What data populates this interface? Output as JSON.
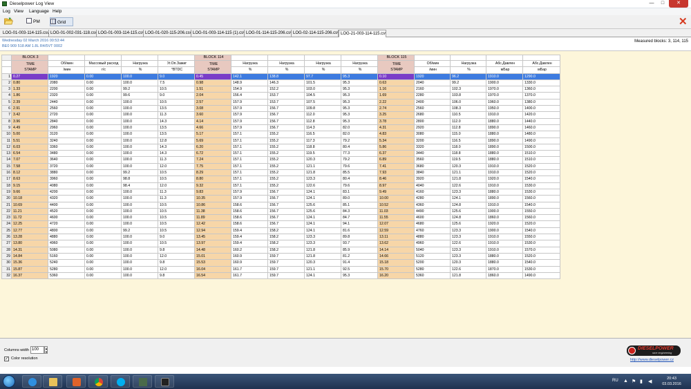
{
  "window": {
    "title": "Dieselpower Log View",
    "minimize": "—",
    "maximize": "□",
    "close": "✕"
  },
  "menu": [
    "Log",
    "View",
    "Language",
    "Help"
  ],
  "toolbar": {
    "pm_label": "PM",
    "grid_label": "Grid",
    "open_icon": "folder-open-icon",
    "exit_icon": "close-x-icon",
    "exit_glyph": "✕"
  },
  "tabs": [
    "LOG-01-003-114-115.csv",
    "LOG-01-002-031-118.csv",
    "LOG-01-003-114-115.csv",
    "LOG-01-020-115-206.csv",
    "LOG-01-003-114-115 (1).csv",
    "LOG-01-114-115-206.csv",
    "LOG-02-114-115-206.csv",
    "LOG-21-003-114-115.csv"
  ],
  "info": {
    "date_line": "Wednesday 02 March 2016 00:53:44",
    "ecu_line": "BE0 909 518 AM   1.8L R4/5VT       0002"
  },
  "measured_blocks": "Measured blocks: 3, 114, 115",
  "grid": {
    "block_headers": {
      "b3": "BLOCK 3",
      "b114": "BLOCK 114",
      "b115": "BLOCK 115"
    },
    "param_names": [
      "",
      "Об/мин",
      "Массовый расход",
      "Нагрузка",
      "Уг.Оп.Зажиг",
      "",
      "Нагрузка",
      "Нагрузка",
      "Нагрузка",
      "Нагрузка",
      "",
      "Об/мин",
      "Нагрузка",
      "Абс.Давлен",
      "Абс.Давлен"
    ],
    "units": [
      "",
      "/мин",
      "г/с",
      "%",
      "°BTDC",
      "",
      "%",
      "%",
      "%",
      "%",
      "",
      "/мин",
      "%",
      "мБар",
      "мБар"
    ],
    "timestamp_label_1": "TIME",
    "timestamp_label_2": "STAMP",
    "rows": [
      [
        "1",
        "0.27",
        "1920",
        "0.00",
        "100.0",
        "9.0",
        "0.45",
        "142.1",
        "138.8",
        "97.7",
        "95.3",
        "0.10",
        "1920",
        "96.2",
        "1910.0",
        "1290.0"
      ],
      [
        "2",
        "0.80",
        "2080",
        "0.00",
        "100.0",
        "7.5",
        "0.98",
        "148.9",
        "146.3",
        "101.5",
        "95.3",
        "0.63",
        "2040",
        "99.2",
        "1900.0",
        "1330.0"
      ],
      [
        "3",
        "1.33",
        "2200",
        "0.00",
        "99.2",
        "10.5",
        "1.51",
        "154.9",
        "152.2",
        "103.0",
        "95.3",
        "1.16",
        "2160",
        "102.3",
        "1970.0",
        "1360.0"
      ],
      [
        "4",
        "1.86",
        "2320",
        "0.00",
        "99.6",
        "9.0",
        "2.04",
        "156.4",
        "153.7",
        "104.5",
        "95.3",
        "1.69",
        "2280",
        "103.8",
        "1970.0",
        "1370.0"
      ],
      [
        "5",
        "2.39",
        "2440",
        "0.00",
        "100.0",
        "10.5",
        "2.57",
        "157.9",
        "153.7",
        "107.5",
        "95.3",
        "2.22",
        "2400",
        "106.0",
        "1960.0",
        "1380.0"
      ],
      [
        "6",
        "2.91",
        "2560",
        "0.00",
        "100.0",
        "13.5",
        "3.08",
        "157.9",
        "156.7",
        "109.8",
        "95.3",
        "2.74",
        "2560",
        "108.3",
        "1950.0",
        "1400.0"
      ],
      [
        "7",
        "3.42",
        "2720",
        "0.00",
        "100.0",
        "11.3",
        "3.60",
        "157.9",
        "156.7",
        "112.0",
        "95.3",
        "3.25",
        "2680",
        "110.5",
        "1910.0",
        "1420.0"
      ],
      [
        "8",
        "3.96",
        "2840",
        "0.00",
        "100.0",
        "14.3",
        "4.14",
        "157.9",
        "156.7",
        "112.8",
        "95.3",
        "3.78",
        "2800",
        "112.0",
        "1880.0",
        "1440.0"
      ],
      [
        "9",
        "4.49",
        "2960",
        "0.00",
        "100.0",
        "13.5",
        "4.66",
        "157.9",
        "156.7",
        "114.3",
        "82.0",
        "4.31",
        "2920",
        "112.8",
        "1890.0",
        "1460.0"
      ],
      [
        "10",
        "5.00",
        "3120",
        "0.00",
        "100.0",
        "13.5",
        "5.17",
        "157.1",
        "155.2",
        "116.5",
        "82.0",
        "4.83",
        "3080",
        "115.0",
        "1880.0",
        "1480.0"
      ],
      [
        "11",
        "5.51",
        "3240",
        "0.00",
        "100.0",
        "12.8",
        "5.69",
        "157.1",
        "155.2",
        "117.3",
        "79.2",
        "5.34",
        "3200",
        "116.5",
        "1890.0",
        "1490.0"
      ],
      [
        "12",
        "6.03",
        "3360",
        "0.00",
        "100.0",
        "14.3",
        "6.20",
        "157.1",
        "155.2",
        "118.8",
        "80.4",
        "5.86",
        "3320",
        "118.0",
        "1890.0",
        "1500.0"
      ],
      [
        "13",
        "6.54",
        "3480",
        "0.00",
        "100.0",
        "14.3",
        "6.72",
        "157.1",
        "155.2",
        "119.5",
        "77.3",
        "6.37",
        "3440",
        "118.8",
        "1880.0",
        "1510.0"
      ],
      [
        "14",
        "7.07",
        "3640",
        "0.00",
        "100.0",
        "11.3",
        "7.24",
        "157.1",
        "155.2",
        "120.3",
        "79.2",
        "6.89",
        "3560",
        "119.5",
        "1880.0",
        "1510.0"
      ],
      [
        "15",
        "7.58",
        "3720",
        "0.00",
        "100.0",
        "12.0",
        "7.75",
        "157.1",
        "155.2",
        "121.1",
        "79.6",
        "7.41",
        "3680",
        "120.3",
        "1910.0",
        "1520.0"
      ],
      [
        "16",
        "8.12",
        "3880",
        "0.00",
        "99.2",
        "10.5",
        "8.29",
        "157.1",
        "155.2",
        "121.8",
        "85.5",
        "7.93",
        "3840",
        "121.1",
        "1910.0",
        "1520.0"
      ],
      [
        "17",
        "8.63",
        "3960",
        "0.00",
        "98.8",
        "10.5",
        "8.80",
        "157.1",
        "155.2",
        "123.3",
        "80.4",
        "8.46",
        "3920",
        "121.8",
        "1920.0",
        "1540.0"
      ],
      [
        "18",
        "9.15",
        "4080",
        "0.00",
        "98.4",
        "12.0",
        "9.32",
        "157.1",
        "155.2",
        "122.6",
        "79.6",
        "8.97",
        "4040",
        "122.6",
        "1910.0",
        "1530.0"
      ],
      [
        "19",
        "9.66",
        "4200",
        "0.00",
        "100.0",
        "11.3",
        "9.83",
        "157.9",
        "156.7",
        "124.1",
        "83.1",
        "9.49",
        "4160",
        "123.3",
        "1880.0",
        "1530.0"
      ],
      [
        "20",
        "10.18",
        "4320",
        "0.00",
        "100.0",
        "11.3",
        "10.35",
        "157.9",
        "156.7",
        "124.1",
        "89.0",
        "10.00",
        "4280",
        "124.1",
        "1890.0",
        "1560.0"
      ],
      [
        "21",
        "10.69",
        "4400",
        "0.00",
        "100.0",
        "10.5",
        "10.86",
        "158.6",
        "156.7",
        "125.6",
        "85.1",
        "10.52",
        "4360",
        "124.8",
        "1910.0",
        "1540.0"
      ],
      [
        "22",
        "11.21",
        "4520",
        "0.00",
        "100.0",
        "10.5",
        "11.38",
        "158.6",
        "156.7",
        "125.6",
        "84.3",
        "11.03",
        "4490",
        "125.6",
        "1900.0",
        "1550.0"
      ],
      [
        "23",
        "11.72",
        "4600",
        "0.00",
        "100.0",
        "10.5",
        "11.89",
        "158.6",
        "156.7",
        "124.1",
        "84.7",
        "11.55",
        "4600",
        "124.8",
        "1860.0",
        "1560.0"
      ],
      [
        "24",
        "12.25",
        "4720",
        "0.00",
        "100.0",
        "10.5",
        "12.42",
        "158.6",
        "156.7",
        "124.1",
        "94.1",
        "12.07",
        "4680",
        "125.6",
        "1920.0",
        "1520.0"
      ],
      [
        "25",
        "12.77",
        "4800",
        "0.00",
        "99.2",
        "10.5",
        "12.94",
        "159.4",
        "158.2",
        "124.1",
        "81.6",
        "12.59",
        "4760",
        "123.3",
        "1900.0",
        "1540.0"
      ],
      [
        "26",
        "13.28",
        "4880",
        "0.00",
        "100.0",
        "9.0",
        "13.45",
        "159.4",
        "158.2",
        "123.3",
        "89.8",
        "13.11",
        "4880",
        "123.3",
        "1910.0",
        "1550.0"
      ],
      [
        "27",
        "13.80",
        "4960",
        "0.00",
        "100.0",
        "10.5",
        "13.97",
        "159.4",
        "158.2",
        "123.3",
        "93.7",
        "13.62",
        "4960",
        "122.6",
        "1910.0",
        "1530.0"
      ],
      [
        "28",
        "14.31",
        "5080",
        "0.00",
        "100.0",
        "9.8",
        "14.48",
        "160.2",
        "158.2",
        "121.8",
        "85.9",
        "14.14",
        "5040",
        "123.3",
        "1910.0",
        "1570.0"
      ],
      [
        "29",
        "14.84",
        "5160",
        "0.00",
        "100.0",
        "12.0",
        "15.01",
        "160.9",
        "159.7",
        "121.8",
        "81.2",
        "14.66",
        "5120",
        "123.3",
        "1880.0",
        "1520.0"
      ],
      [
        "30",
        "15.36",
        "5240",
        "0.00",
        "100.0",
        "9.8",
        "15.53",
        "160.9",
        "159.7",
        "120.3",
        "91.4",
        "15.18",
        "5200",
        "120.3",
        "1880.0",
        "1540.0"
      ],
      [
        "31",
        "15.87",
        "5280",
        "0.00",
        "100.0",
        "12.0",
        "16.04",
        "161.7",
        "159.7",
        "121.1",
        "92.5",
        "15.70",
        "5280",
        "122.6",
        "1870.0",
        "1530.0"
      ],
      [
        "32",
        "16.37",
        "5360",
        "0.00",
        "100.0",
        "9.8",
        "16.54",
        "161.7",
        "159.7",
        "124.1",
        "95.3",
        "16.20",
        "5360",
        "121.8",
        "1860.0",
        "1490.0"
      ]
    ]
  },
  "bottom": {
    "columns_width_label": "Columns width",
    "columns_width_value": "100",
    "color_resolution_label": "Color resolution",
    "color_resolution_checked": "✓",
    "logo_brand": "DIESELPOWER",
    "logo_tag": "race engineering",
    "website": "http://www.dieselpower.cz"
  },
  "taskbar": {
    "apps": [
      "explorer-icon",
      "ie-icon",
      "folder-icon",
      "media-player-icon",
      "chrome-icon",
      "skype-icon",
      "terminal-icon",
      "camera-icon"
    ],
    "lang": "RU",
    "time": "20:43",
    "date": "03.03.2016"
  },
  "colors": {
    "timestamp_cell": "#f7d6a8",
    "block_header": "#e8c9c0",
    "grid_background": "#fdf6da",
    "selected_row": "#3d7be0",
    "selected_timestamp": "#7a3cc8"
  }
}
